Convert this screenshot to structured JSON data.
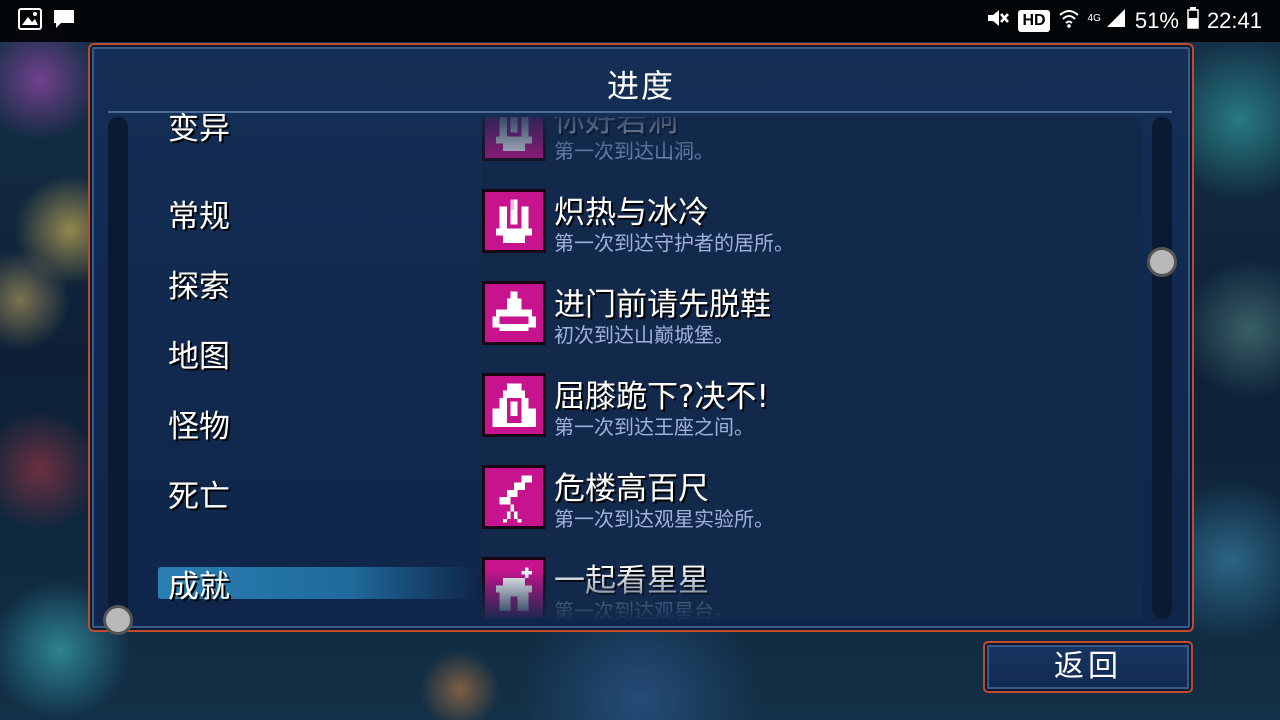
{
  "status_bar": {
    "battery": "51%",
    "time": "22:41",
    "network": "4G",
    "hd": "HD",
    "icons": [
      "image-icon",
      "message-icon",
      "mute-icon",
      "wifi-icon",
      "signal-icon",
      "battery-icon"
    ]
  },
  "panel": {
    "title": "进度"
  },
  "categories": {
    "partial_top": "变异",
    "items": [
      "常规",
      "探索",
      "地图",
      "怪物",
      "死亡"
    ],
    "selected": "成就"
  },
  "achievements": [
    {
      "title": "你好岩洞",
      "desc": "第一次到达山洞。",
      "icon": "crystal-icon"
    },
    {
      "title": "炽热与冰冷",
      "desc": "第一次到达守护者的居所。",
      "icon": "crystal-icon"
    },
    {
      "title": "进门前请先脱鞋",
      "desc": "初次到达山巅城堡。",
      "icon": "crown-icon"
    },
    {
      "title": "屈膝跪下?决不!",
      "desc": "第一次到达王座之间。",
      "icon": "throne-icon"
    },
    {
      "title": "危楼高百尺",
      "desc": "第一次到达观星实验所。",
      "icon": "telescope-icon"
    },
    {
      "title": "一起看星星",
      "desc": "第一次到达观星台。",
      "icon": "observatory-icon"
    }
  ],
  "buttons": {
    "return_label": "返回"
  },
  "colors": {
    "panel_border": "#c14a2c",
    "icon_bg": "#c8138e",
    "selected_bg": "#2a7fb2",
    "desc_text": "#9fb0dd"
  }
}
